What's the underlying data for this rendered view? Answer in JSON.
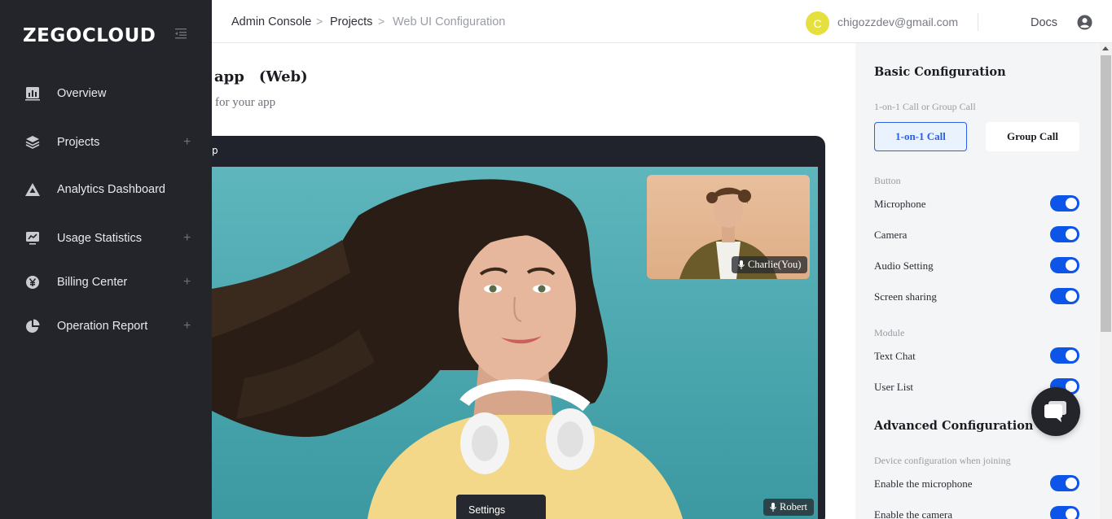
{
  "sidebar": {
    "logo": "ZEGOCLOUD",
    "items": [
      {
        "label": "Overview",
        "icon": "bar-chart-icon",
        "expandable": false
      },
      {
        "label": "Projects",
        "icon": "layers-icon",
        "expandable": true
      },
      {
        "label": "Analytics Dashboard",
        "icon": "triangle-pyramid-icon",
        "expandable": false
      },
      {
        "label": "Usage Statistics",
        "icon": "monitor-chart-icon",
        "expandable": true
      },
      {
        "label": "Billing Center",
        "icon": "yen-coin-icon",
        "expandable": true
      },
      {
        "label": "Operation Report",
        "icon": "pie-chart-icon",
        "expandable": true
      }
    ],
    "plus_symbol": "+"
  },
  "header": {
    "breadcrumb": [
      "Admin Console",
      "Projects",
      "Web UI Configuration"
    ],
    "separator": ">",
    "avatar_letter": "C",
    "email": "chigozzdev@gmail.com",
    "docs_label": "Docs",
    "accent_avatar": "#e6e03f"
  },
  "main": {
    "title": "app　(Web)",
    "subtitle": "for your app",
    "preview_header": "p",
    "pip_name": "Charlie(You)",
    "main_name": "Robert",
    "settings_menu": "Settings"
  },
  "config": {
    "basic_title": "Basic Configuration",
    "call_type_caption": "1-on-1 Call or Group Call",
    "call_types": [
      "1-on-1 Call",
      "Group Call"
    ],
    "selected_call_type": "1-on-1 Call",
    "button_caption": "Button",
    "buttons": [
      {
        "label": "Microphone",
        "on": true
      },
      {
        "label": "Camera",
        "on": true
      },
      {
        "label": "Audio Setting",
        "on": true
      },
      {
        "label": "Screen sharing",
        "on": true
      }
    ],
    "module_caption": "Module",
    "modules": [
      {
        "label": "Text Chat",
        "on": true
      },
      {
        "label": "User List",
        "on": true
      }
    ],
    "advanced_title": "Advanced Configuration",
    "device_caption": "Device configuration when joining",
    "device_options": [
      {
        "label": "Enable the microphone",
        "on": true
      },
      {
        "label": "Enable the camera",
        "on": true
      }
    ],
    "toggle_color": "#0d55e8"
  }
}
